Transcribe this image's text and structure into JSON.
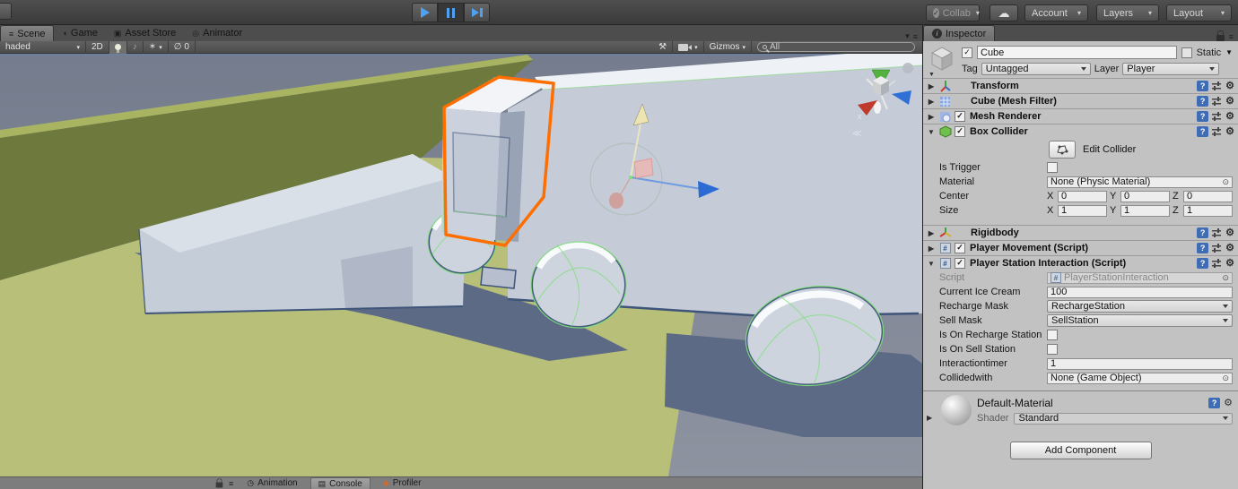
{
  "icons": {
    "check": "✓",
    "dropdown": "▾",
    "menu": "≡",
    "foldout_open": "▼",
    "foldout_closed": "▶",
    "gear": "⚙",
    "help": "?",
    "cloud": "☁",
    "info": "i",
    "hash": "#",
    "scene_tab": "≡",
    "game_tab": "◖",
    "asset_store_tab": "▣",
    "animator_tab": "◎",
    "tools": "⚒",
    "effects": "✶",
    "audio": "♪",
    "eye_off": "∅",
    "clock": "◷",
    "console": "▤",
    "profiler": "◆",
    "picker": "⊙",
    "axis_x": "x",
    "persp": "≪"
  },
  "colors": {
    "selection_orange": "#ff6e00",
    "play_blue": "#4da2f2",
    "ground_olive": "#b7bf79",
    "wall_olive": "#6d793d",
    "sky_gray": "#7e8596"
  },
  "topbar": {
    "collab": "Collab",
    "account": "Account",
    "layers": "Layers",
    "layout": "Layout"
  },
  "tabs": {
    "scene": "Scene",
    "game": "Game",
    "asset_store": "Asset Store",
    "animator": "Animator",
    "inspector": "Inspector"
  },
  "scene_toolbar": {
    "shading": "haded",
    "two_d": "2D",
    "gizmo_count": "0",
    "gizmos": "Gizmos",
    "search": "All"
  },
  "inspector": {
    "name": "Cube",
    "static": "Static",
    "tag_label": "Tag",
    "tag": "Untagged",
    "layer_label": "Layer",
    "layer": "Player",
    "transform": "Transform",
    "mesh_filter": "Cube (Mesh Filter)",
    "mesh_renderer": "Mesh Renderer",
    "box_collider": {
      "title": "Box Collider",
      "edit": "Edit Collider",
      "is_trigger": "Is Trigger",
      "material_label": "Material",
      "material": "None (Physic Material)",
      "center_label": "Center",
      "size_label": "Size",
      "x": "X",
      "y": "Y",
      "z": "Z",
      "center_x": "0",
      "center_y": "0",
      "center_z": "0",
      "size_x": "1",
      "size_y": "1",
      "size_z": "1"
    },
    "rigidbody": "Rigidbody",
    "player_movement": "Player Movement (Script)",
    "station": {
      "title": "Player Station Interaction (Script)",
      "script_label": "Script",
      "script": "PlayerStationInteraction",
      "ice_label": "Current Ice Cream",
      "ice": "100",
      "recharge_label": "Recharge Mask",
      "recharge": "RechargeStation",
      "sell_label": "Sell Mask",
      "sell": "SellStation",
      "on_recharge": "Is On Recharge Station",
      "on_sell": "Is On Sell Station",
      "timer_label": "Interactiontimer",
      "timer": "1",
      "collided_label": "Collidedwith",
      "collided": "None (Game Object)"
    },
    "material": {
      "name": "Default-Material",
      "shader_label": "Shader",
      "shader": "Standard"
    },
    "add_component": "Add Component"
  },
  "bottom": {
    "animation": "Animation",
    "console": "Console",
    "profiler": "Profiler"
  }
}
